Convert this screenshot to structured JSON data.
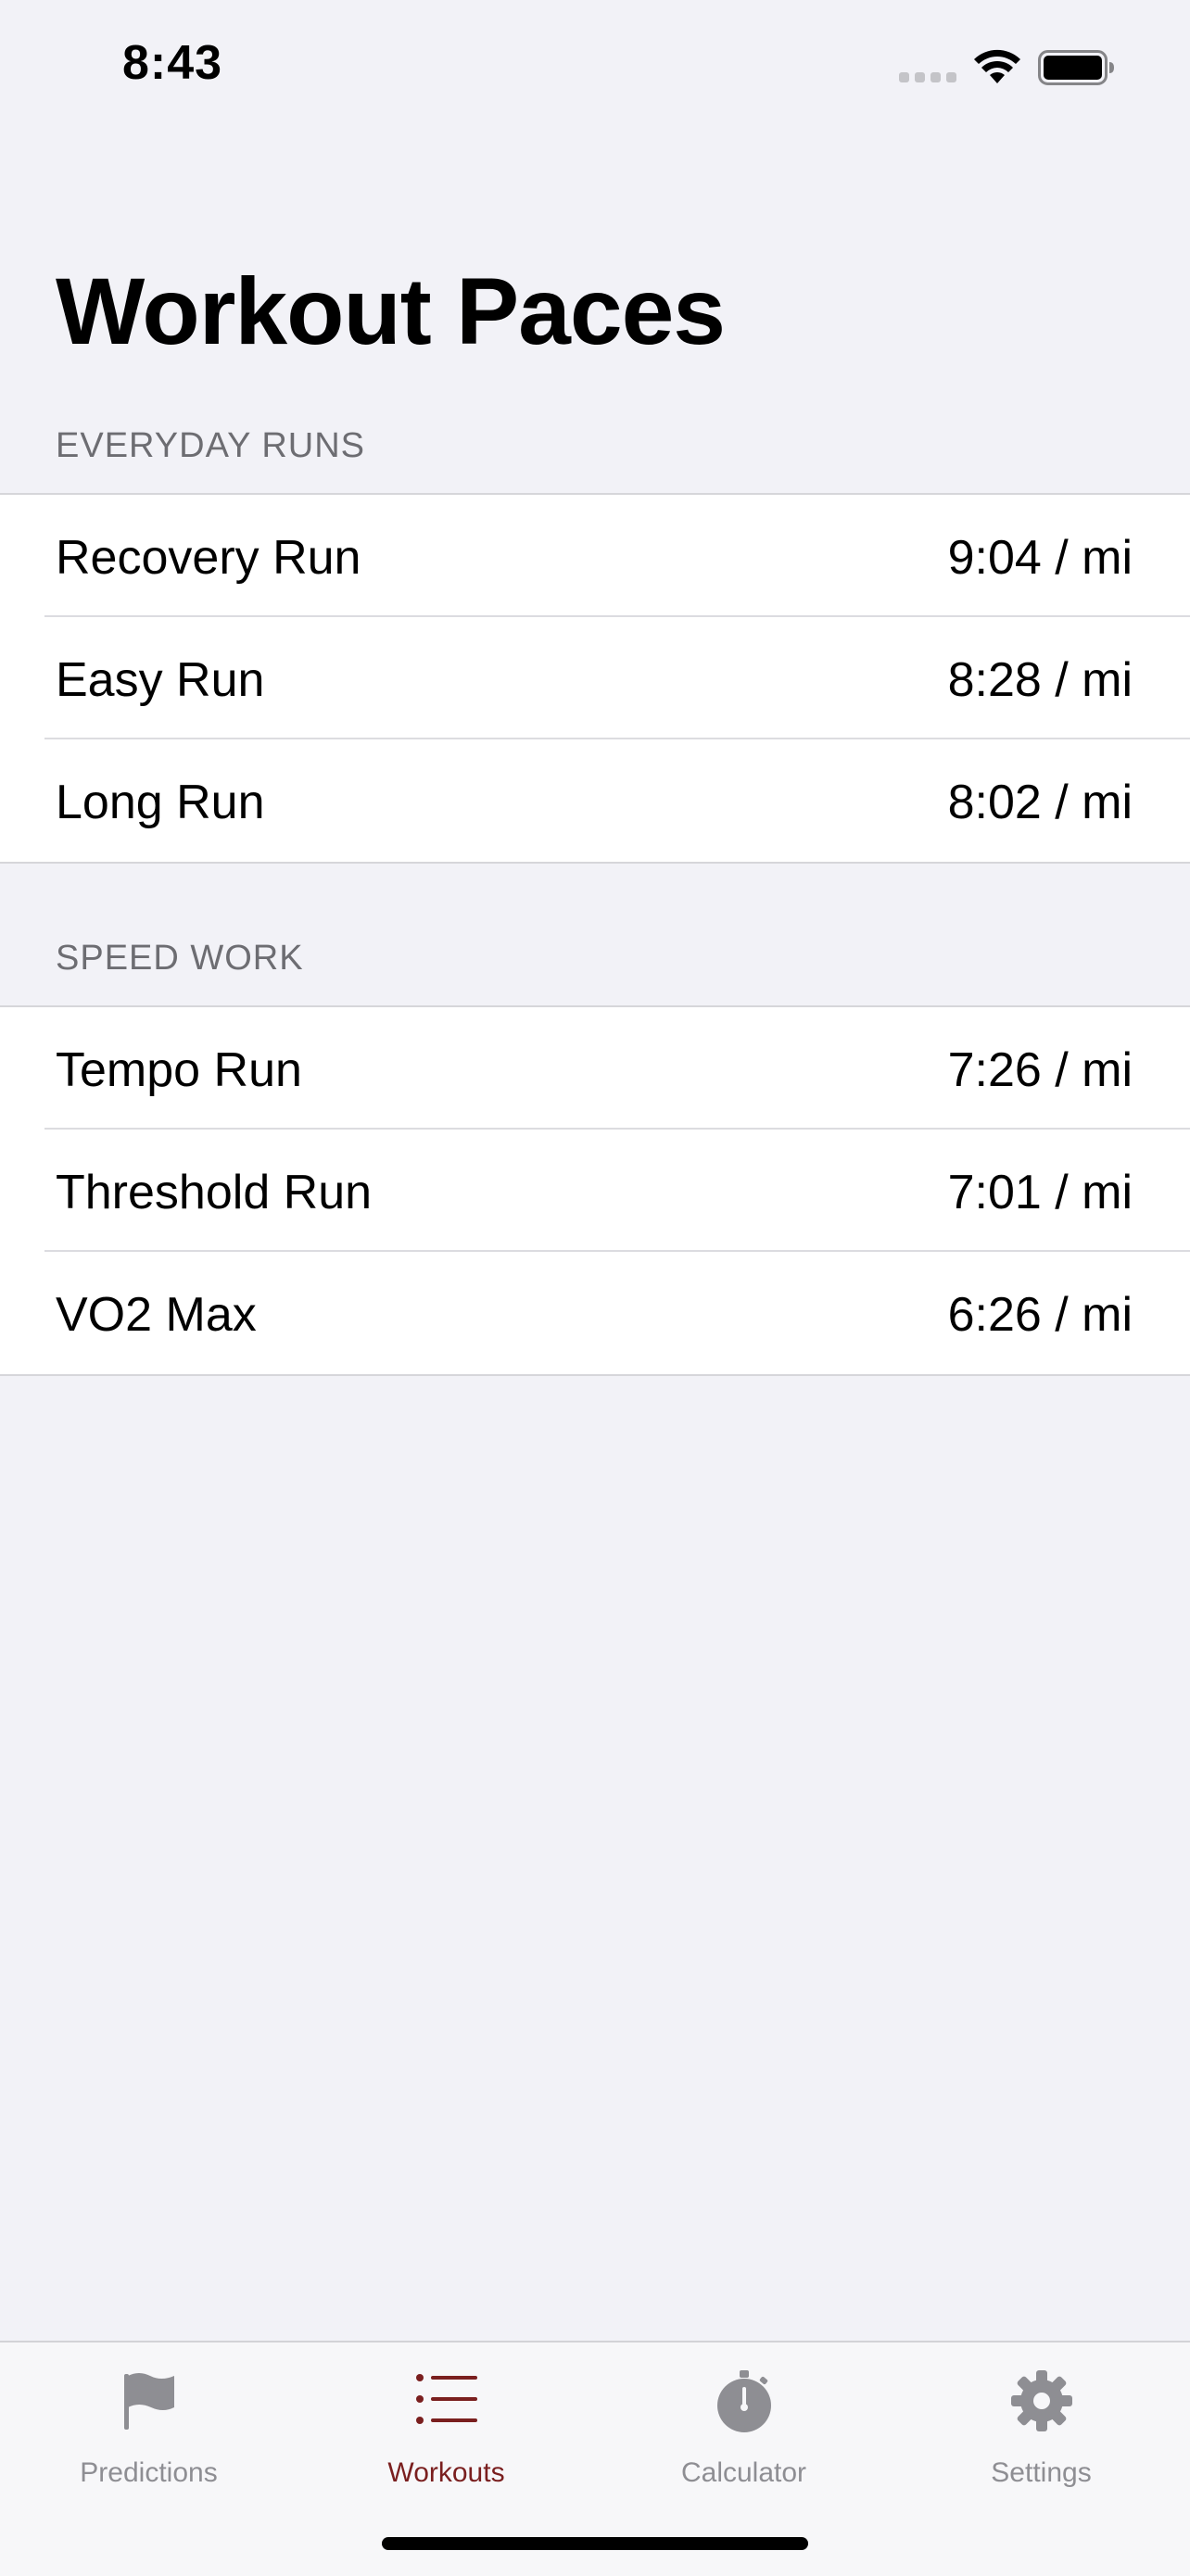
{
  "status_bar": {
    "time": "8:43"
  },
  "title": "Workout Paces",
  "sections": [
    {
      "header": "EVERYDAY RUNS",
      "rows": [
        {
          "label": "Recovery Run",
          "value": "9:04 / mi"
        },
        {
          "label": "Easy Run",
          "value": "8:28 / mi"
        },
        {
          "label": "Long Run",
          "value": "8:02 / mi"
        }
      ]
    },
    {
      "header": "SPEED WORK",
      "rows": [
        {
          "label": "Tempo Run",
          "value": "7:26 / mi"
        },
        {
          "label": "Threshold Run",
          "value": "7:01 / mi"
        },
        {
          "label": "VO2 Max",
          "value": "6:26 / mi"
        }
      ]
    }
  ],
  "tab_bar": {
    "tabs": [
      {
        "label": "Predictions",
        "icon": "flag-icon",
        "active": false
      },
      {
        "label": "Workouts",
        "icon": "list-icon",
        "active": true
      },
      {
        "label": "Calculator",
        "icon": "stopwatch-icon",
        "active": false
      },
      {
        "label": "Settings",
        "icon": "gear-icon",
        "active": false
      }
    ]
  },
  "colors": {
    "accent": "#7a1f1f",
    "inactive_tab": "#8e8e93",
    "background": "#f2f2f7"
  }
}
